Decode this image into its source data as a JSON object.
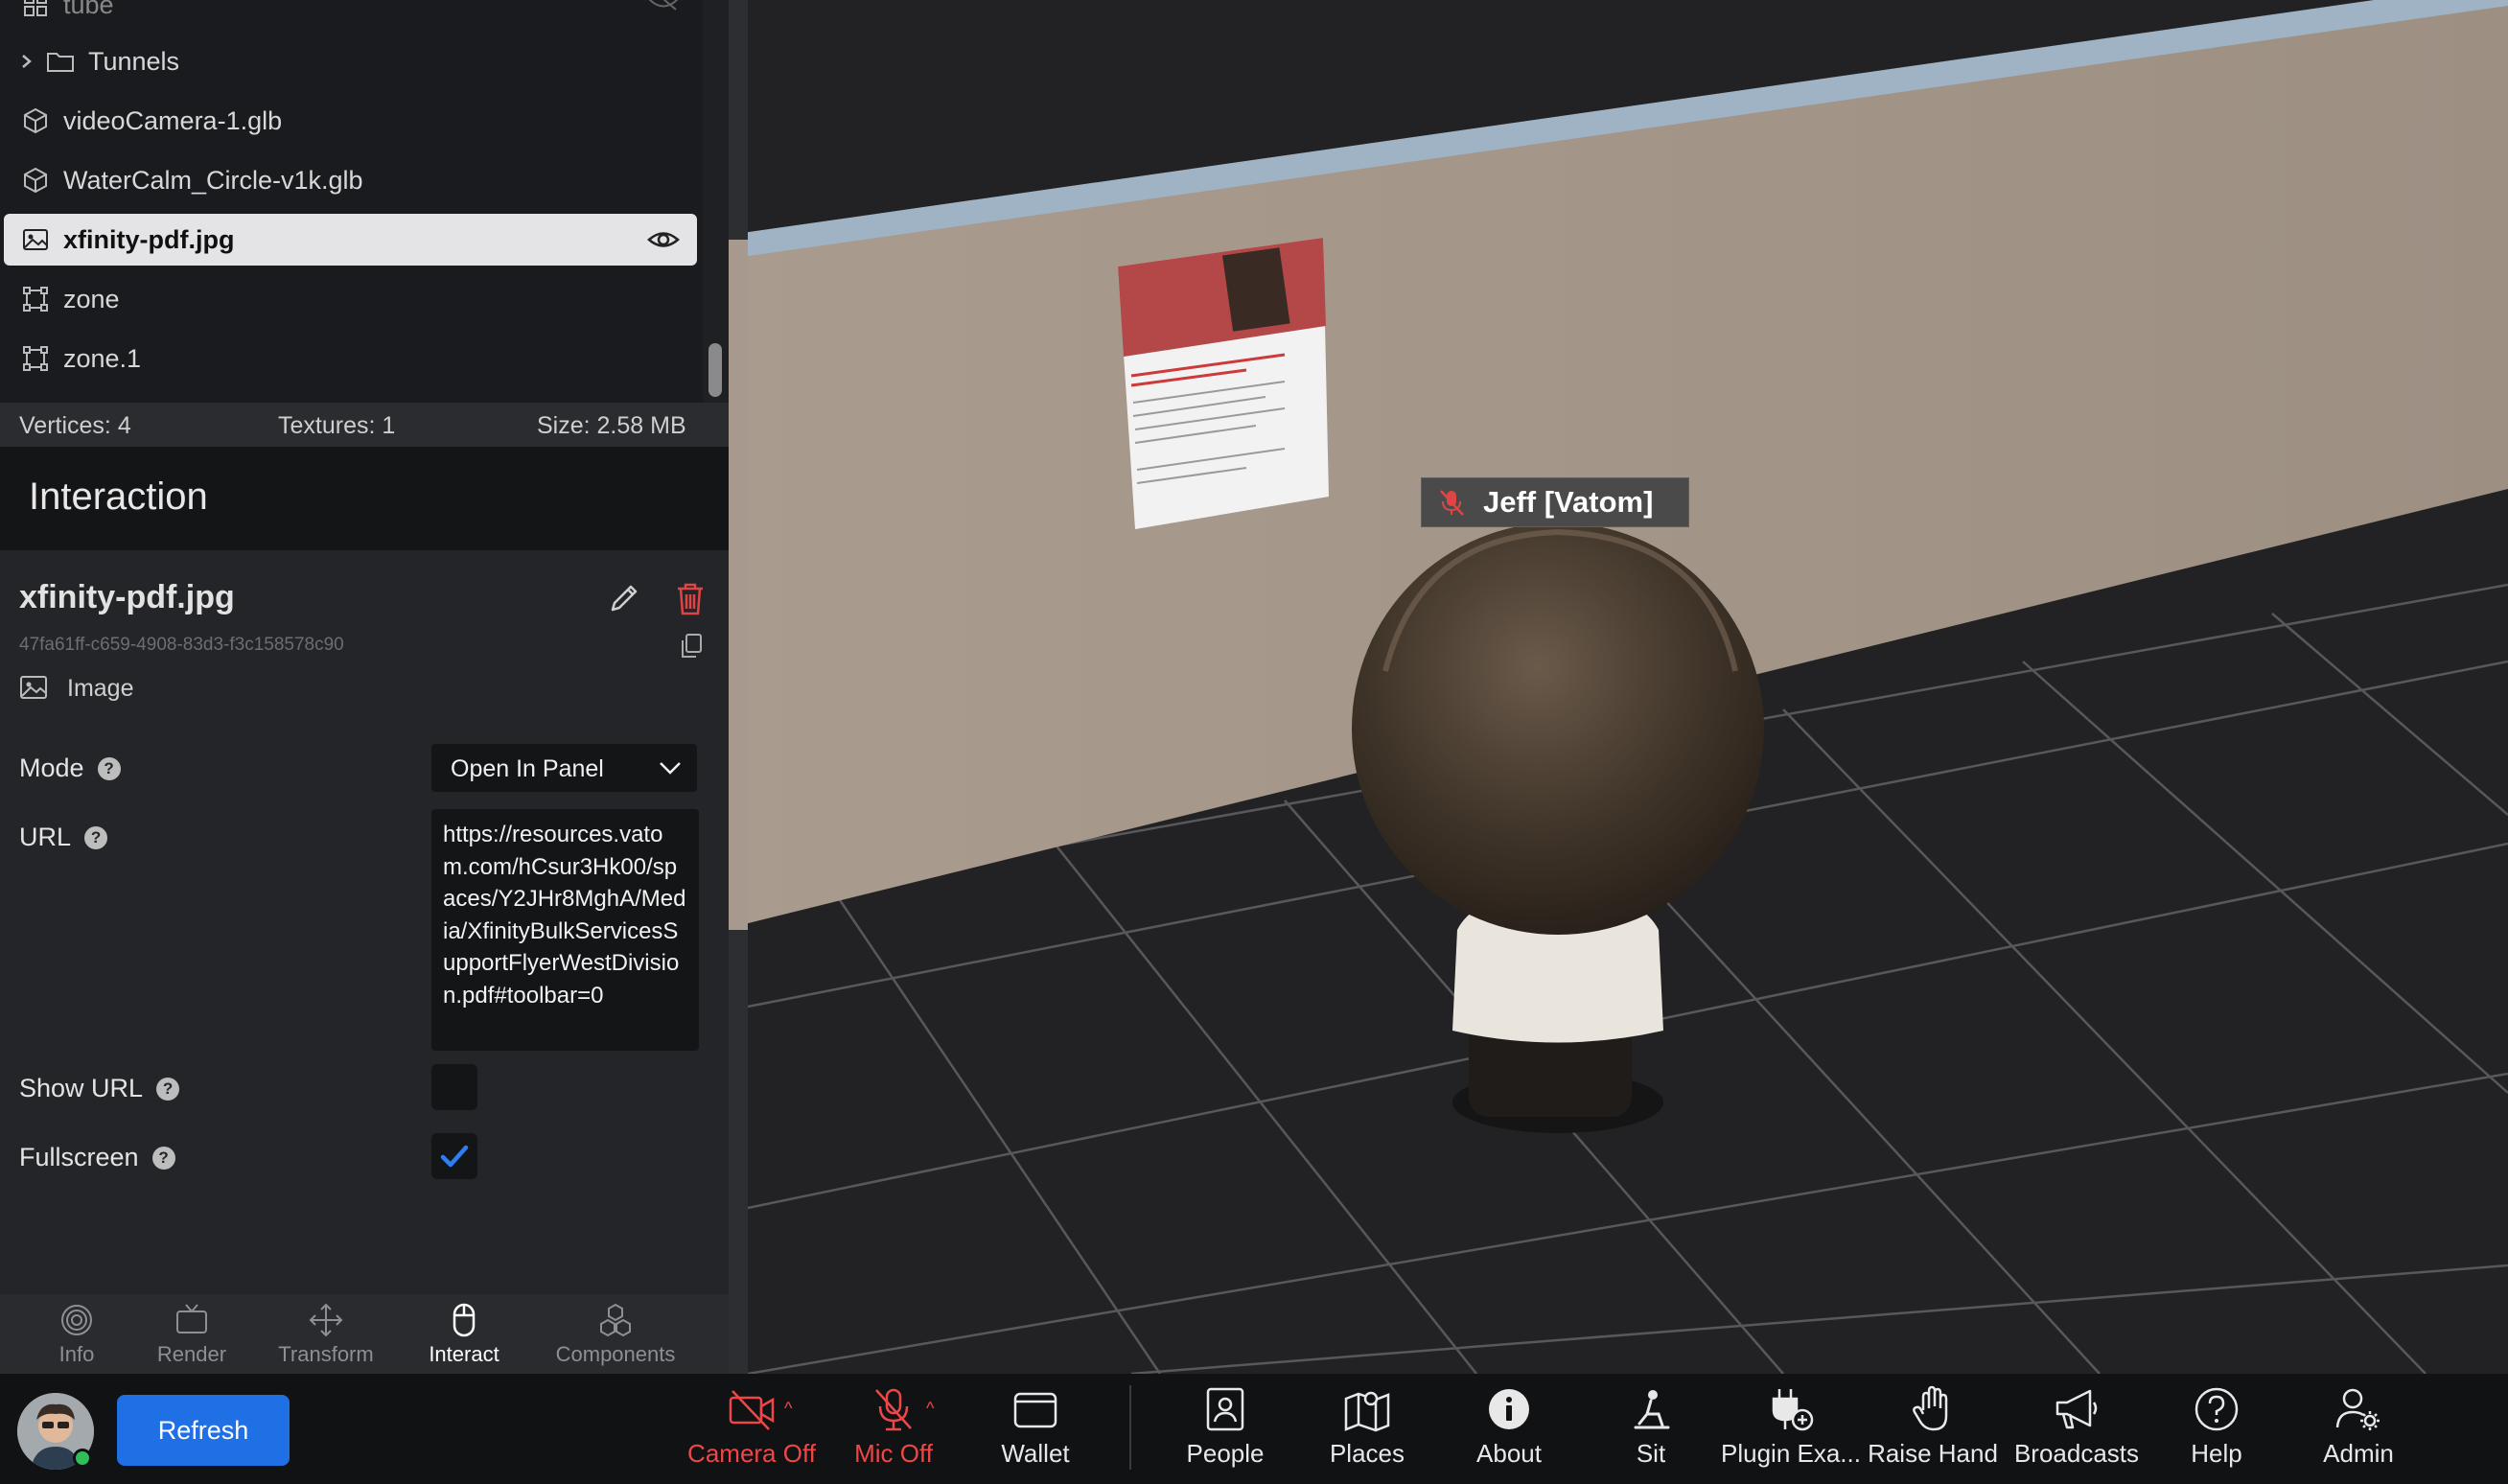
{
  "outliner": {
    "items": [
      {
        "label": "tube",
        "icon": "mesh-group-icon",
        "partial": true
      },
      {
        "label": "Tunnels",
        "icon": "folder-icon",
        "expandable": true
      },
      {
        "label": "videoCamera-1.glb",
        "icon": "cube-icon"
      },
      {
        "label": "WaterCalm_Circle-v1k.glb",
        "icon": "cube-icon"
      },
      {
        "label": "xfinity-pdf.jpg",
        "icon": "image-icon",
        "selected": true
      },
      {
        "label": "zone",
        "icon": "zone-icon"
      },
      {
        "label": "zone.1",
        "icon": "zone-icon"
      }
    ]
  },
  "stats": {
    "vertices": "Vertices: 4",
    "textures": "Textures: 1",
    "size": "Size: 2.58 MB"
  },
  "interaction": {
    "title": "Interaction"
  },
  "inspector": {
    "name": "xfinity-pdf.jpg",
    "uuid": "47fa61ff-c659-4908-83d3-f3c158578c90",
    "type": "Image",
    "mode_label": "Mode",
    "mode_value": "Open In Panel",
    "url_label": "URL",
    "url_value": "https://resources.vatom.com/hCsur3Hk00/spaces/Y2JHr8MghA/Media/XfinityBulkServicesSupportFlyerWestDivision.pdf#toolbar=0",
    "show_url_label": "Show URL",
    "show_url_checked": false,
    "fullscreen_label": "Fullscreen",
    "fullscreen_checked": true,
    "help_glyph": "?"
  },
  "panel_tabs": [
    {
      "label": "Info",
      "icon": "target-icon",
      "active": false
    },
    {
      "label": "Render",
      "icon": "tv-icon",
      "active": false
    },
    {
      "label": "Transform",
      "icon": "move-icon",
      "active": false
    },
    {
      "label": "Interact",
      "icon": "mouse-icon",
      "active": true
    },
    {
      "label": "Components",
      "icon": "boxes-icon",
      "active": false
    }
  ],
  "scene": {
    "nameplate": "Jeff [Vatom]",
    "colors": {
      "floor": "#232325",
      "grid": "#5b5b5e",
      "wall": "#a59889",
      "wall_top": "#9fb3c4"
    }
  },
  "toolbar": {
    "refresh_label": "Refresh",
    "items": [
      {
        "label": "Camera Off",
        "icon": "camera-off-icon",
        "off": true
      },
      {
        "label": "Mic Off",
        "icon": "mic-off-icon",
        "off": true
      },
      {
        "label": "Wallet",
        "icon": "wallet-icon"
      },
      {
        "label": "People",
        "icon": "people-icon"
      },
      {
        "label": "Places",
        "icon": "map-icon"
      },
      {
        "label": "About",
        "icon": "info-icon"
      },
      {
        "label": "Sit",
        "icon": "sit-icon"
      },
      {
        "label": "Plugin Exa...",
        "icon": "plugin-icon"
      },
      {
        "label": "Raise Hand",
        "icon": "hand-icon"
      },
      {
        "label": "Broadcasts",
        "icon": "megaphone-icon"
      },
      {
        "label": "Help",
        "icon": "help-circle-icon"
      },
      {
        "label": "Admin",
        "icon": "admin-icon"
      }
    ],
    "accent": "#1f6fe5",
    "off_color": "#ef4747"
  }
}
